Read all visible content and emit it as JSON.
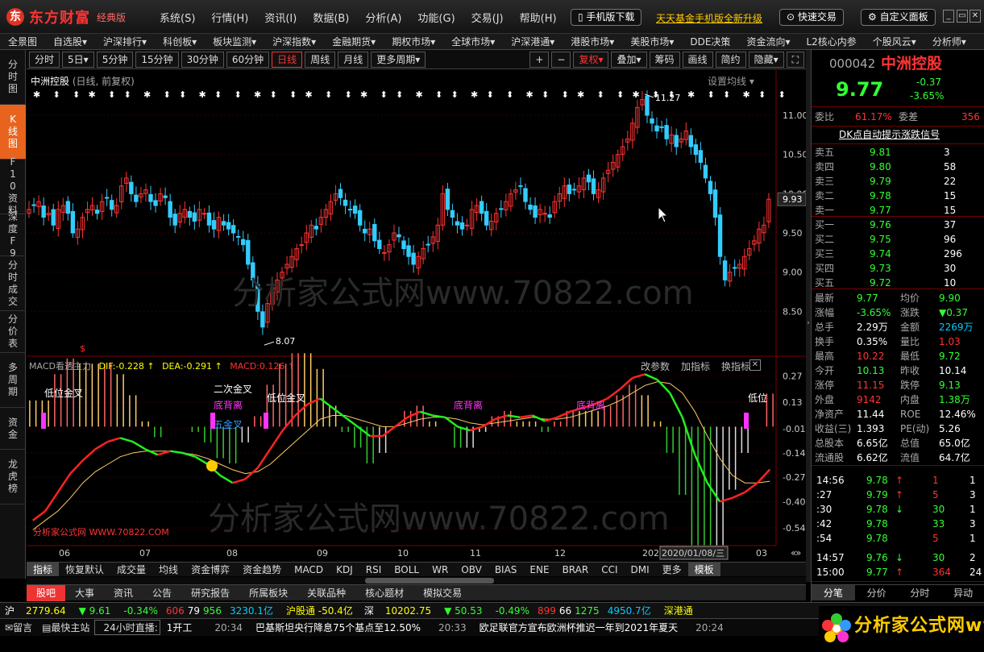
{
  "app": {
    "brand": "东方财富",
    "edition": "经典版"
  },
  "menu": [
    "系统(S)",
    "行情(H)",
    "资讯(I)",
    "数据(B)",
    "分析(A)",
    "功能(G)",
    "交易(J)",
    "帮助(H)"
  ],
  "title_pills": {
    "mobile_download": "手机版下载",
    "quick_trade": "快速交易",
    "custom_panel": "自定义面板"
  },
  "promo": "天天基金手机版全新升级",
  "navbar": [
    "全景图",
    "自选股▾",
    "沪深排行▾",
    "科创板▾",
    "板块监测▾",
    "沪深指数▾",
    "金融期货▾",
    "期权市场▾",
    "全球市场▾",
    "沪深港通▾",
    "港股市场▾",
    "美股市场▾",
    "DDE决策",
    "资金流向▾",
    "L2核心内参",
    "个股风云▾",
    "分析师▾"
  ],
  "leftnav": [
    {
      "label": "分时图",
      "active": false
    },
    {
      "label": "K线图",
      "active": true
    },
    {
      "label": "F10资料",
      "active": false
    },
    {
      "label": "深度F9",
      "active": false
    },
    {
      "label": "分时成交",
      "active": false
    },
    {
      "label": "分价表",
      "active": false
    },
    {
      "label": "多周期",
      "active": false
    },
    {
      "label": "资金",
      "active": false
    },
    {
      "label": "龙虎榜",
      "active": false
    }
  ],
  "periods": [
    {
      "label": "分时"
    },
    {
      "label": "5日▾"
    },
    {
      "label": "5分钟"
    },
    {
      "label": "15分钟"
    },
    {
      "label": "30分钟"
    },
    {
      "label": "60分钟"
    },
    {
      "label": "日线",
      "active": true
    },
    {
      "label": "周线"
    },
    {
      "label": "月线"
    },
    {
      "label": "更多周期▾"
    }
  ],
  "toolbar_right": [
    "+",
    "−",
    "复权▾",
    "叠加▾",
    "筹码",
    "画线",
    "简约",
    "隐藏▾",
    "⛶"
  ],
  "chart": {
    "title": "中洲控股",
    "subtitle": "(日线, 前复权)",
    "set_ma": "设置均线 ▾",
    "price_labels": [
      "11.00",
      "10.50",
      "10.00",
      "9.50",
      "9.00",
      "8.50"
    ],
    "current_price_tag": "9.93",
    "high_label": "11.27",
    "low_label": "8.07"
  },
  "macd": {
    "name": "MACD看透主力",
    "dif": "DIF:-0.228 ↑",
    "dea": "DEA:-0.291 ↑",
    "macd": "MACD:0.126 ↑",
    "buttons": [
      "改参数",
      "加指标",
      "换指标"
    ],
    "axis": [
      "0.27",
      "0.13",
      "-0.01",
      "-0.14",
      "-0.27",
      "-0.40",
      "-0.54"
    ],
    "annotations": [
      {
        "text": "低位金叉",
        "color": "#ffffff"
      },
      {
        "text": "二次金叉",
        "color": "#ffffff"
      },
      {
        "text": "低位金叉",
        "color": "#ffffff"
      },
      {
        "text": "底背离",
        "color": "#ff33ff"
      },
      {
        "text": "底背离",
        "color": "#ff33ff"
      },
      {
        "text": "底背离",
        "color": "#ff33ff"
      },
      {
        "text": "低位",
        "color": "#ffffff"
      },
      {
        "text": "五金叉",
        "color": "#3399ff"
      }
    ],
    "watermark_text": "分析家公式网 WWW.70822.COM"
  },
  "x_axis": [
    "06",
    "07",
    "08",
    "09",
    "10",
    "11",
    "12",
    "202",
    "2020/01/08/三",
    "03"
  ],
  "watermark": "分析家公式网www.70822.com",
  "indicators": [
    "指标",
    "恢复默认",
    "成交量",
    "均线",
    "资金博弈",
    "资金趋势",
    "MACD",
    "KDJ",
    "RSI",
    "BOLL",
    "WR",
    "OBV",
    "BIAS",
    "ENE",
    "BRAR",
    "CCI",
    "DMI",
    "更多",
    "模板"
  ],
  "newstabs": [
    "股吧",
    "大事",
    "资讯",
    "公告",
    "研究报告",
    "所属板块",
    "关联品种",
    "核心题材",
    "模拟交易"
  ],
  "ticker": {
    "sh_label": "沪",
    "sh_index": "2779.64",
    "sh_chg": "▼ 9.61",
    "sh_pct": "-0.34%",
    "sh_up": "606",
    "sh_flat": "79",
    "sh_down": "956",
    "sh_amt": "3230.1亿",
    "hgt": "沪股通 -50.4亿",
    "sz_label": "深",
    "sz_index": "10202.75",
    "sz_chg": "▼ 50.53",
    "sz_pct": "-0.49%",
    "sz_up": "899",
    "sz_flat": "66",
    "sz_down": "1275",
    "sz_amt": "4950.7亿",
    "sgt": "深港通"
  },
  "status": {
    "leave_msg": "留言",
    "nearest_site": "最快主站",
    "live": "24小时直播:",
    "news1": "1开工",
    "t1": "20:34",
    "news2": "巴基斯坦央行降息75个基点至12.50%",
    "t2": "20:33",
    "news3": "欧足联官方宣布欧洲杯推迟一年到2021年夏天",
    "t3": "20:24"
  },
  "quote": {
    "code": "000042",
    "name": "中洲控股",
    "price": "9.77",
    "change": "-0.37",
    "pct": "-3.65%",
    "weibi_label": "委比",
    "weibi": "61.17%",
    "weicha_label": "委差",
    "weicha": "356",
    "signal": "DK点自动提示涨跌信号",
    "asks": [
      {
        "label": "卖五",
        "price": "9.81",
        "vol": "3"
      },
      {
        "label": "卖四",
        "price": "9.80",
        "vol": "58"
      },
      {
        "label": "卖三",
        "price": "9.79",
        "vol": "22"
      },
      {
        "label": "卖二",
        "price": "9.78",
        "vol": "15"
      },
      {
        "label": "卖一",
        "price": "9.77",
        "vol": "15"
      }
    ],
    "bids": [
      {
        "label": "买一",
        "price": "9.76",
        "vol": "37"
      },
      {
        "label": "买二",
        "price": "9.75",
        "vol": "96"
      },
      {
        "label": "买三",
        "price": "9.74",
        "vol": "296"
      },
      {
        "label": "买四",
        "price": "9.73",
        "vol": "30"
      },
      {
        "label": "买五",
        "price": "9.72",
        "vol": "10"
      }
    ],
    "stats": [
      {
        "l1": "最新",
        "v1": "9.77",
        "c1": "green",
        "l2": "均价",
        "v2": "9.90",
        "c2": "green"
      },
      {
        "l1": "涨幅",
        "v1": "-3.65%",
        "c1": "green",
        "l2": "涨跌",
        "v2": "▼0.37",
        "c2": "green"
      },
      {
        "l1": "总手",
        "v1": "2.29万",
        "c1": "white",
        "l2": "金额",
        "v2": "2269万",
        "c2": "cyan"
      },
      {
        "l1": "换手",
        "v1": "0.35%",
        "c1": "white",
        "l2": "量比",
        "v2": "1.03",
        "c2": "red"
      },
      {
        "l1": "最高",
        "v1": "10.22",
        "c1": "red",
        "l2": "最低",
        "v2": "9.72",
        "c2": "green"
      },
      {
        "l1": "今开",
        "v1": "10.13",
        "c1": "green",
        "l2": "昨收",
        "v2": "10.14",
        "c2": "white"
      },
      {
        "l1": "涨停",
        "v1": "11.15",
        "c1": "red",
        "l2": "跌停",
        "v2": "9.13",
        "c2": "green"
      },
      {
        "l1": "外盘",
        "v1": "9142",
        "c1": "red",
        "l2": "内盘",
        "v2": "1.38万",
        "c2": "green"
      },
      {
        "l1": "净资产",
        "v1": "11.44",
        "c1": "white",
        "l2": "ROE",
        "v2": "12.46%",
        "c2": "white"
      },
      {
        "l1": "收益(三)",
        "v1": "1.393",
        "c1": "white",
        "l2": "PE(动)",
        "v2": "5.26",
        "c2": "white"
      },
      {
        "l1": "总股本",
        "v1": "6.65亿",
        "c1": "white",
        "l2": "总值",
        "v2": "65.0亿",
        "c2": "white"
      },
      {
        "l1": "流通股",
        "v1": "6.62亿",
        "c1": "white",
        "l2": "流值",
        "v2": "64.7亿",
        "c2": "white"
      }
    ],
    "ticks": [
      {
        "time": "14:56",
        "price": "9.78",
        "arrow": "↑",
        "vol": "1",
        "n": "1",
        "vc": "red"
      },
      {
        "time": ":27",
        "price": "9.79",
        "arrow": "↑",
        "vol": "5",
        "n": "3",
        "vc": "red"
      },
      {
        "time": ":30",
        "price": "9.78",
        "arrow": "↓",
        "vol": "30",
        "n": "1",
        "vc": "green"
      },
      {
        "time": ":42",
        "price": "9.78",
        "arrow": "",
        "vol": "33",
        "n": "3",
        "vc": "green"
      },
      {
        "time": ":54",
        "price": "9.78",
        "arrow": "",
        "vol": "5",
        "n": "1",
        "vc": "red"
      },
      {
        "time": "14:57",
        "price": "9.76",
        "arrow": "↓",
        "vol": "30",
        "n": "2",
        "vc": "green"
      },
      {
        "time": "15:00",
        "price": "9.77",
        "arrow": "↑",
        "vol": "364",
        "n": "24",
        "vc": "red"
      }
    ],
    "tabs": [
      "分笔",
      "分价",
      "分时",
      "异动"
    ]
  },
  "chart_data": {
    "type": "candlestick",
    "x_ticks": [
      "06",
      "07",
      "08",
      "09",
      "10",
      "11",
      "12",
      "202",
      "03"
    ],
    "y_ticks": [
      11.0,
      10.5,
      10.0,
      9.5,
      9.0,
      8.5
    ],
    "ylim": [
      8.0,
      11.35
    ],
    "high": 11.27,
    "low": 8.07,
    "last": 9.93,
    "closes": [
      9.8,
      9.85,
      9.9,
      9.7,
      9.75,
      9.6,
      9.8,
      9.85,
      9.75,
      9.5,
      9.55,
      9.7,
      9.8,
      9.85,
      9.75,
      9.9,
      9.95,
      9.8,
      9.85,
      10.1,
      10.2,
      10.0,
      9.9,
      10.0,
      10.05,
      9.9,
      9.85,
      10.0,
      9.95,
      9.7,
      9.6,
      9.75,
      9.8,
      9.7,
      9.65,
      9.8,
      9.75,
      9.6,
      9.55,
      9.7,
      9.6,
      9.55,
      9.5,
      9.45,
      9.35,
      9.1,
      8.9,
      8.5,
      8.3,
      8.6,
      8.8,
      8.9,
      9.0,
      9.1,
      9.2,
      9.3,
      9.35,
      9.5,
      9.6,
      9.55,
      9.7,
      9.8,
      9.9,
      10.0,
      9.95,
      9.85,
      9.8,
      9.75,
      9.6,
      9.5,
      9.55,
      9.4,
      9.3,
      9.25,
      9.35,
      9.5,
      9.45,
      9.3,
      9.2,
      9.1,
      9.2,
      9.3,
      9.35,
      9.45,
      9.6,
      10.0,
      9.8,
      9.7,
      9.6,
      9.55,
      9.6,
      9.8,
      9.85,
      9.75,
      9.6,
      9.65,
      9.75,
      9.8,
      9.9,
      10.0,
      10.05,
      10.1,
      9.9,
      9.8,
      9.7,
      9.8,
      9.75,
      9.7,
      9.9,
      10.0,
      10.1,
      10.0,
      10.05,
      10.1,
      10.2,
      10.15,
      10.0,
      10.05,
      10.2,
      10.3,
      10.4,
      10.5,
      10.6,
      10.7,
      10.9,
      11.1,
      11.2,
      11.0,
      10.9,
      10.8,
      10.85,
      10.7,
      10.75,
      10.6,
      10.7,
      10.8,
      10.6,
      10.5,
      10.4,
      10.2,
      10.0,
      9.7,
      9.2,
      8.9,
      9.0,
      9.05,
      9.1,
      9.2,
      9.3,
      9.4,
      9.55,
      9.6,
      9.93
    ],
    "macd_dif": [
      -0.5,
      -0.45,
      -0.35,
      -0.25,
      -0.18,
      -0.12,
      -0.08,
      -0.06,
      -0.08,
      -0.12,
      -0.15,
      -0.13,
      -0.14,
      -0.16,
      -0.2,
      -0.26,
      -0.3,
      -0.28,
      -0.22,
      -0.12,
      -0.02,
      0.06,
      0.12,
      0.15,
      0.1,
      0.05,
      0.0,
      -0.05,
      -0.05,
      0.0,
      0.05,
      0.08,
      0.06,
      0.05,
      0.0,
      -0.02,
      0.0,
      0.04,
      0.06,
      0.05,
      0.06,
      0.03,
      0.05,
      0.08,
      0.1,
      0.12,
      0.15,
      0.2,
      0.26,
      0.28,
      0.25,
      0.18,
      0.05,
      -0.15,
      -0.3,
      -0.4,
      -0.38,
      -0.35,
      -0.3,
      -0.228
    ],
    "macd_dea": [
      -0.55,
      -0.5,
      -0.45,
      -0.38,
      -0.3,
      -0.24,
      -0.2,
      -0.16,
      -0.14,
      -0.13,
      -0.13,
      -0.13,
      -0.14,
      -0.15,
      -0.17,
      -0.2,
      -0.23,
      -0.25,
      -0.24,
      -0.2,
      -0.14,
      -0.08,
      -0.02,
      0.04,
      0.06,
      0.06,
      0.04,
      0.02,
      0.0,
      0.0,
      0.02,
      0.04,
      0.05,
      0.05,
      0.04,
      0.02,
      0.01,
      0.02,
      0.03,
      0.04,
      0.05,
      0.04,
      0.04,
      0.05,
      0.07,
      0.09,
      0.11,
      0.14,
      0.18,
      0.22,
      0.24,
      0.23,
      0.18,
      0.08,
      -0.05,
      -0.17,
      -0.26,
      -0.3,
      -0.3,
      -0.291
    ]
  }
}
